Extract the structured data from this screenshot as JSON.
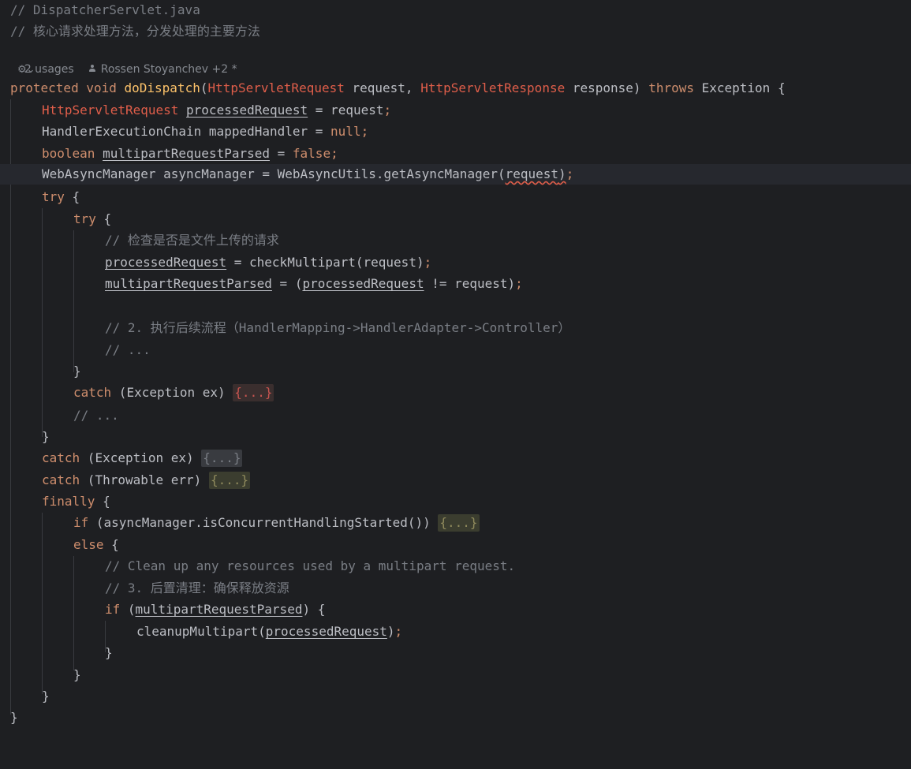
{
  "header": {
    "file_comment": "// DispatcherServlet.java",
    "desc_comment": "// 核心请求处理方法，分发处理的主要方法",
    "usages": "2 usages",
    "authors": "Rossen Stoyanchev +2 *"
  },
  "code": {
    "l1_a": "protected void ",
    "l1_b": "doDispatch",
    "l1_c": "(",
    "l1_d": "HttpServletRequest",
    "l1_e": " request, ",
    "l1_f": "HttpServletResponse",
    "l1_g": " response) ",
    "l1_h": "throws",
    "l1_i": " Exception {",
    "l2_a": "HttpServletRequest",
    "l2_b": " ",
    "l2_c": "processedRequest",
    "l2_d": " = request",
    "l2_e": ";",
    "l3_a": "HandlerExecutionChain mappedHandler = ",
    "l3_b": "null",
    "l3_c": ";",
    "l4_a": "boolean",
    "l4_b": " ",
    "l4_c": "multipartRequestParsed",
    "l4_d": " = ",
    "l4_e": "false",
    "l4_f": ";",
    "l5_a": "WebAsyncManager asyncManager = WebAsyncUtils.getAsyncManager(",
    "l5_b": "request",
    "l5_c": ")",
    "l5_d": ";",
    "l6_a": "try",
    "l6_b": " {",
    "l7_a": "try",
    "l7_b": " {",
    "l8": "// 检查是否是文件上传的请求",
    "l9_a": "processedRequest",
    "l9_b": " = checkMultipart(request)",
    "l9_c": ";",
    "l10_a": "multipartRequestParsed",
    "l10_b": " = (",
    "l10_c": "processedRequest",
    "l10_d": " != request)",
    "l10_e": ";",
    "l12": "// 2. 执行后续流程（HandlerMapping->HandlerAdapter->Controller）",
    "l13": "// ...",
    "l14": "}",
    "l15_a": "catch",
    "l15_b": " (Exception ex) ",
    "l15_c": "{...}",
    "l16": "// ...",
    "l17": "}",
    "l18_a": "catch",
    "l18_b": " (Exception ex) ",
    "l18_c": "{...}",
    "l19_a": "catch",
    "l19_b": " (Throwable err) ",
    "l19_c": "{...}",
    "l20_a": "finally",
    "l20_b": " {",
    "l21_a": "if",
    "l21_b": " (asyncManager.isConcurrentHandlingStarted()) ",
    "l21_c": "{...}",
    "l22_a": "else",
    "l22_b": " {",
    "l23": "// Clean up any resources used by a multipart request.",
    "l24": "// 3. 后置清理：确保释放资源",
    "l25_a": "if",
    "l25_b": " (",
    "l25_c": "multipartRequestParsed",
    "l25_d": ") {",
    "l26_a": "cleanupMultipart(",
    "l26_b": "processedRequest",
    "l26_c": ")",
    "l26_d": ";",
    "l27": "}",
    "l28": "}",
    "l29": "}",
    "l30": "}"
  },
  "colors": {
    "background": "#1e1f22",
    "keyword": "#cf8e6d",
    "comment": "#7a7e85",
    "text": "#bcbec4",
    "method_decl": "#56a8f5",
    "warn_type": "#e05e4a"
  }
}
